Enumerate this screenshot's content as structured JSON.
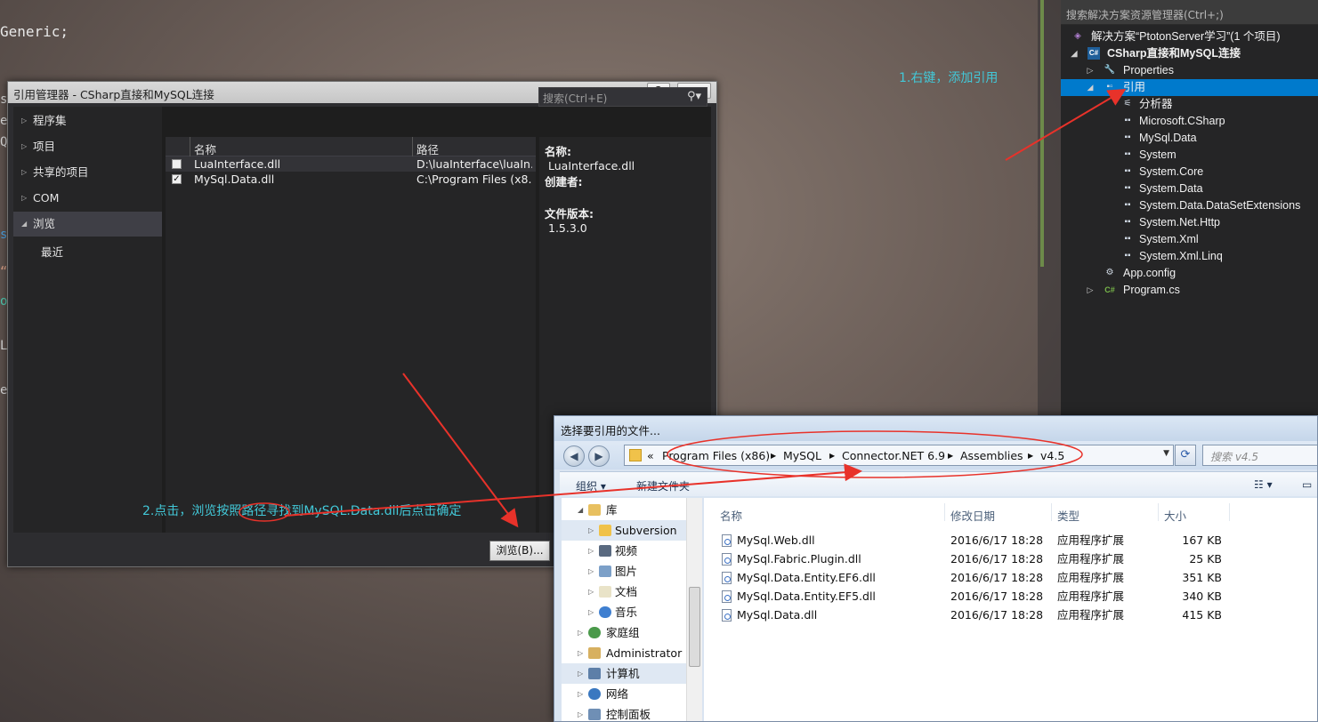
{
  "editor": {
    "line1": "Generic;",
    "fragments": [
      "s",
      "e",
      "Q",
      "s",
      "“",
      "o",
      "L",
      "e"
    ]
  },
  "annotations": {
    "step1": "1.右键，添加引用",
    "step2": "2.点击，浏览按照路径寻找到MySQL.Data.dll后点击确定"
  },
  "solution_explorer": {
    "search_placeholder": "搜索解决方案资源管理器(Ctrl+;)",
    "solution": "解决方案“PtotonServer学习”(1 个项目)",
    "project": "CSharp直接和MySQL连接",
    "items": [
      {
        "label": "Properties",
        "icon": "wrench-icon"
      },
      {
        "label": "引用",
        "icon": "references-icon"
      },
      {
        "label": "分析器",
        "icon": "analyzer-icon"
      },
      {
        "label": "Microsoft.CSharp",
        "icon": "reference-icon"
      },
      {
        "label": "MySql.Data",
        "icon": "reference-icon"
      },
      {
        "label": "System",
        "icon": "reference-icon"
      },
      {
        "label": "System.Core",
        "icon": "reference-icon"
      },
      {
        "label": "System.Data",
        "icon": "reference-icon"
      },
      {
        "label": "System.Data.DataSetExtensions",
        "icon": "reference-icon"
      },
      {
        "label": "System.Net.Http",
        "icon": "reference-icon"
      },
      {
        "label": "System.Xml",
        "icon": "reference-icon"
      },
      {
        "label": "System.Xml.Linq",
        "icon": "reference-icon"
      },
      {
        "label": "App.config",
        "icon": "config-icon"
      },
      {
        "label": "Program.cs",
        "icon": "csharp-file-icon"
      }
    ]
  },
  "reference_manager": {
    "title": "引用管理器 - CSharp直接和MySQL连接",
    "help_btn": "?",
    "close_btn": "✕",
    "categories": [
      "程序集",
      "项目",
      "共享的项目",
      "COM",
      "浏览",
      "最近"
    ],
    "search_placeholder": "搜索(Ctrl+E)",
    "columns": {
      "name": "名称",
      "path": "路径"
    },
    "rows": [
      {
        "name": "LuaInterface.dll",
        "path": "D:\\luaInterface\\luaIn...",
        "checked": false
      },
      {
        "name": "MySql.Data.dll",
        "path": "C:\\Program Files (x8...",
        "checked": true
      }
    ],
    "detail": {
      "name_label": "名称:",
      "name_value": "LuaInterface.dll",
      "author_label": "创建者:",
      "version_label": "文件版本:",
      "version_value": "1.5.3.0"
    },
    "browse_button": "浏览(B)..."
  },
  "file_dialog": {
    "title": "选择要引用的文件...",
    "breadcrumb": [
      "«",
      "Program Files (x86)",
      "MySQL",
      "Connector.NET 6.9",
      "Assemblies",
      "v4.5"
    ],
    "search_placeholder": "搜索 v4.5",
    "toolbar": {
      "organize": "组织 ▾",
      "new_folder": "新建文件夹"
    },
    "tree": [
      {
        "label": "库",
        "indent": 0,
        "icon": "library-icon"
      },
      {
        "label": "Subversion",
        "indent": 1,
        "icon": "folder-icon",
        "selected": true
      },
      {
        "label": "视频",
        "indent": 1,
        "icon": "video-icon"
      },
      {
        "label": "图片",
        "indent": 1,
        "icon": "picture-icon"
      },
      {
        "label": "文档",
        "indent": 1,
        "icon": "document-icon"
      },
      {
        "label": "音乐",
        "indent": 1,
        "icon": "music-icon"
      },
      {
        "label": "家庭组",
        "indent": 0,
        "icon": "homegroup-icon"
      },
      {
        "label": "Administrator",
        "indent": 0,
        "icon": "user-folder-icon"
      },
      {
        "label": "计算机",
        "indent": 0,
        "icon": "computer-icon",
        "selected": true
      },
      {
        "label": "网络",
        "indent": 0,
        "icon": "network-icon"
      },
      {
        "label": "控制面板",
        "indent": 0,
        "icon": "control-panel-icon"
      }
    ],
    "columns": {
      "name": "名称",
      "modified": "修改日期",
      "type": "类型",
      "size": "大小"
    },
    "files": [
      {
        "name": "MySql.Web.dll",
        "modified": "2016/6/17 18:28",
        "type": "应用程序扩展",
        "size": "167 KB"
      },
      {
        "name": "MySql.Fabric.Plugin.dll",
        "modified": "2016/6/17 18:28",
        "type": "应用程序扩展",
        "size": "25 KB"
      },
      {
        "name": "MySql.Data.Entity.EF6.dll",
        "modified": "2016/6/17 18:28",
        "type": "应用程序扩展",
        "size": "351 KB"
      },
      {
        "name": "MySql.Data.Entity.EF5.dll",
        "modified": "2016/6/17 18:28",
        "type": "应用程序扩展",
        "size": "340 KB"
      },
      {
        "name": "MySql.Data.dll",
        "modified": "2016/6/17 18:28",
        "type": "应用程序扩展",
        "size": "415 KB"
      }
    ]
  },
  "colors": {
    "vs_selection": "#007acc",
    "annotation_text": "#42c8d8",
    "annotation_arrow": "#e8322a"
  }
}
